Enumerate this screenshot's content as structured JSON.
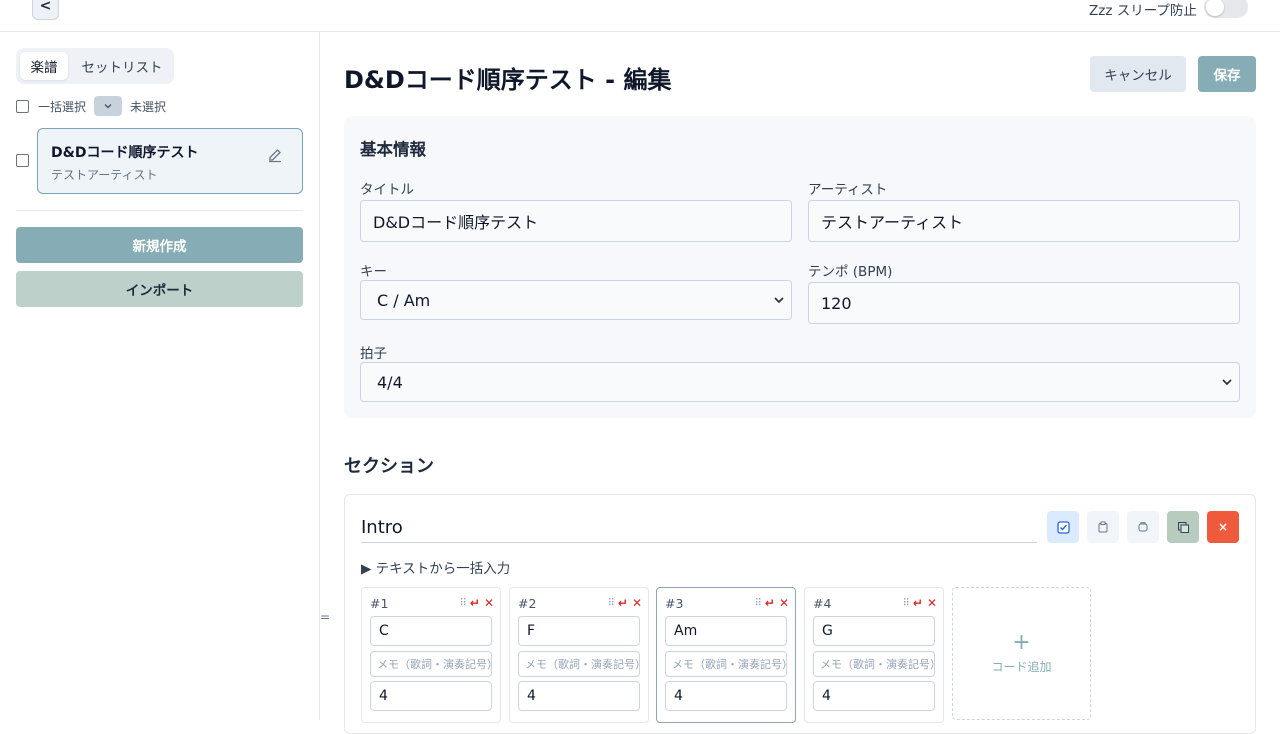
{
  "topbar": {
    "back_label": "<",
    "sleep_label": "Zzz スリープ防止",
    "sleep_enabled": false
  },
  "sidebar": {
    "tabs": [
      {
        "label": "楽譜",
        "active": true
      },
      {
        "label": "セットリスト",
        "active": false
      }
    ],
    "bulk_select_label": "一括選択",
    "bulk_select_status": "未選択",
    "songs": [
      {
        "title": "D&Dコード順序テスト",
        "artist": "テストアーティスト",
        "selected": true
      }
    ],
    "new_button": "新規作成",
    "import_button": "インポート"
  },
  "editor": {
    "page_title": "D&Dコード順序テスト - 編集",
    "cancel_button": "キャンセル",
    "save_button": "保存",
    "basic_info": {
      "heading": "基本情報",
      "title_label": "タイトル",
      "title_value": "D&Dコード順序テスト",
      "artist_label": "アーティスト",
      "artist_value": "テストアーティスト",
      "key_label": "キー",
      "key_value": "C / Am",
      "tempo_label": "テンポ (BPM)",
      "tempo_value": "120",
      "time_sig_label": "拍子",
      "time_sig_value": "4/4"
    },
    "sections_heading": "セクション",
    "section": {
      "name": "Intro",
      "bulk_input_label": "▶ テキストから一括入力",
      "drag_handle": "=",
      "chords": [
        {
          "num": "#1",
          "chord": "C",
          "memo_placeholder": "メモ（歌詞・演奏記号）",
          "beats": "4"
        },
        {
          "num": "#2",
          "chord": "F",
          "memo_placeholder": "メモ（歌詞・演奏記号）",
          "beats": "4"
        },
        {
          "num": "#3",
          "chord": "Am",
          "memo_placeholder": "メモ（歌詞・演奏記号）",
          "beats": "4"
        },
        {
          "num": "#4",
          "chord": "G",
          "memo_placeholder": "メモ（歌詞・演奏記号）",
          "beats": "4"
        }
      ],
      "add_chord_plus": "+",
      "add_chord_label": "コード追加",
      "delete_label": "×"
    }
  },
  "colors": {
    "accent": "#86adb5",
    "danger": "#ef5a3c",
    "selected_card_bg": "#eef4f8"
  }
}
